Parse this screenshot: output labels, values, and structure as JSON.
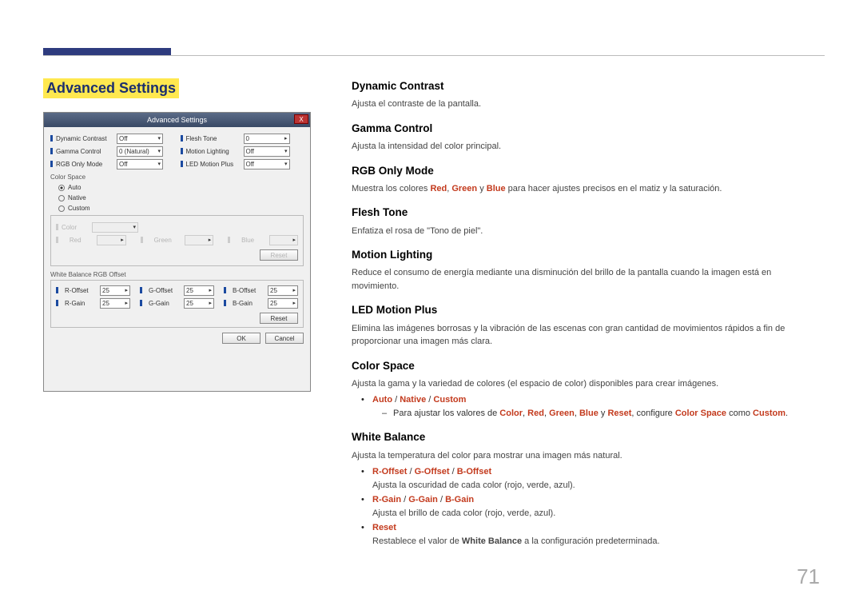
{
  "page_number": "71",
  "section_title": "Advanced Settings",
  "dialog": {
    "title": "Advanced Settings",
    "close": "X",
    "rows_left": [
      {
        "label": "Dynamic Contrast",
        "value": "Off"
      },
      {
        "label": "Gamma Control",
        "value": "0 (Natural)"
      },
      {
        "label": "RGB Only Mode",
        "value": "Off"
      }
    ],
    "rows_right": [
      {
        "label": "Flesh Tone",
        "value": "0"
      },
      {
        "label": "Motion Lighting",
        "value": "Off"
      },
      {
        "label": "LED Motion Plus",
        "value": "Off"
      }
    ],
    "color_space": {
      "group": "Color Space",
      "options": [
        "Auto",
        "Native",
        "Custom"
      ],
      "selected": "Auto",
      "custom_fields": [
        {
          "label": "Color",
          "value": ""
        },
        {
          "label": "Red",
          "value": ""
        },
        {
          "label": "Green",
          "value": ""
        },
        {
          "label": "Blue",
          "value": ""
        }
      ],
      "reset": "Reset"
    },
    "white_balance": {
      "group": "White Balance RGB Offset",
      "fields": [
        {
          "label": "R-Offset",
          "value": "25"
        },
        {
          "label": "G-Offset",
          "value": "25"
        },
        {
          "label": "B-Offset",
          "value": "25"
        },
        {
          "label": "R-Gain",
          "value": "25"
        },
        {
          "label": "G-Gain",
          "value": "25"
        },
        {
          "label": "B-Gain",
          "value": "25"
        }
      ],
      "reset": "Reset"
    },
    "ok": "OK",
    "cancel": "Cancel"
  },
  "body": {
    "dynamic_contrast": {
      "h": "Dynamic Contrast",
      "p": "Ajusta el contraste de la pantalla."
    },
    "gamma_control": {
      "h": "Gamma Control",
      "p": "Ajusta la intensidad del color principal."
    },
    "rgb_only_mode": {
      "h": "RGB Only Mode",
      "pre": "Muestra los colores ",
      "r": "Red",
      "sep1": ", ",
      "g": "Green",
      "sep2": " y ",
      "b": "Blue",
      "post": " para hacer ajustes precisos en el matiz y la saturación."
    },
    "flesh_tone": {
      "h": "Flesh Tone",
      "p": "Enfatiza el rosa de \"Tono de piel\"."
    },
    "motion_lighting": {
      "h": "Motion Lighting",
      "p": "Reduce el consumo de energía mediante una disminución del brillo de la pantalla cuando la imagen está en movimiento."
    },
    "led_motion_plus": {
      "h": "LED Motion Plus",
      "p": "Elimina las imágenes borrosas y la vibración de las escenas con gran cantidad de movimientos rápidos a fin de proporcionar una imagen más clara."
    },
    "color_space": {
      "h": "Color Space",
      "p": "Ajusta la gama y la variedad de colores (el espacio de color) disponibles para crear imágenes.",
      "opts": {
        "auto": "Auto",
        "sep": " / ",
        "native": "Native",
        "custom": "Custom"
      },
      "sub_pre": "Para ajustar los valores de ",
      "sub_color": "Color",
      "c1": ", ",
      "sub_red": "Red",
      "c2": ", ",
      "sub_green": "Green",
      "c3": ", ",
      "sub_blue": "Blue",
      "c4": " y ",
      "sub_reset": "Reset",
      "sub_mid": ", configure ",
      "sub_cs": "Color Space",
      "sub_mid2": " como ",
      "sub_custom": "Custom",
      "sub_end": "."
    },
    "white_balance": {
      "h": "White Balance",
      "p": "Ajusta la temperatura del color para mostrar una imagen más natural.",
      "li1": {
        "r": "R-Offset",
        "sep": " / ",
        "g": "G-Offset",
        "b": "B-Offset",
        "desc": "Ajusta la oscuridad de cada color (rojo, verde, azul)."
      },
      "li2": {
        "r": "R-Gain",
        "sep": " / ",
        "g": "G-Gain",
        "b": "B-Gain",
        "desc": "Ajusta el brillo de cada color (rojo, verde, azul)."
      },
      "li3": {
        "reset": "Reset",
        "desc_pre": "Restablece el valor de ",
        "desc_wb": "White Balance",
        "desc_post": " a la configuración predeterminada."
      }
    }
  }
}
